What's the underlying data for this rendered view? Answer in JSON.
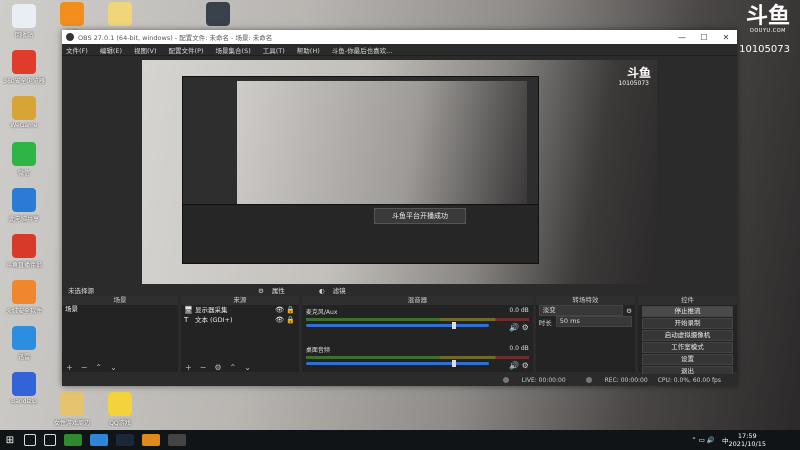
{
  "desktop": {
    "icons_left": [
      {
        "label": "回收站",
        "color": "#e8eef3"
      },
      {
        "label": "360安全浏览器",
        "color": "#e13b2c"
      },
      {
        "label": "WeGame",
        "color": "#d7a437"
      },
      {
        "label": "微信",
        "color": "#2fb446"
      },
      {
        "label": "此电脑共享",
        "color": "#2a7ad6"
      },
      {
        "label": "斗鱼直播伴侣",
        "color": "#d83a2a"
      },
      {
        "label": "火绒安全软件",
        "color": "#f0872c"
      },
      {
        "label": "迅雷",
        "color": "#2d8ee0"
      },
      {
        "label": "Bandizip",
        "color": "#3264d8"
      }
    ],
    "icons_top": [
      {
        "label": "斗鱼",
        "color": "#f28e1c"
      },
      {
        "label": "",
        "color": "#f1d57a"
      },
      {
        "label": "",
        "color": "#39414a"
      }
    ],
    "icons_bottom": [
      {
        "label": "女性游戏周边",
        "color": "#e6c36e"
      },
      {
        "label": "QQ游戏",
        "color": "#f4d23c"
      }
    ],
    "watermark": {
      "logo": "斗鱼",
      "site": "DOUYU.COM",
      "room": "10105073"
    }
  },
  "obs": {
    "title": "OBS 27.0.1 (64-bit, windows) - 配置文件: 未命名 - 场景: 未命名",
    "window_controls": [
      "—",
      "☐",
      "✕"
    ],
    "menu": [
      "文件(F)",
      "编辑(E)",
      "视图(V)",
      "配置文件(P)",
      "场景集合(S)",
      "工具(T)",
      "帮助(H)",
      "斗鱼-你最后也喜欢..."
    ],
    "preview": {
      "toast": "斗鱼平台开播成功",
      "logo": "斗鱼",
      "room": "10105073"
    },
    "scene_bar": {
      "current": "未选择源",
      "properties": "属性",
      "filters": "滤镜"
    },
    "docks": {
      "scenes": {
        "title": "场景",
        "items": [
          "场景"
        ]
      },
      "sources": {
        "title": "来源",
        "items": [
          {
            "icon": "🖥",
            "label": "显示器采集"
          },
          {
            "icon": "T",
            "label": "文本 (GDI+)"
          }
        ]
      },
      "mixer": {
        "title": "混音器",
        "channels": [
          {
            "name": "麦克风/Aux",
            "db": "0.0 dB"
          },
          {
            "name": "桌面音频",
            "db": "0.0 dB"
          }
        ]
      },
      "transitions": {
        "title": "转场特效",
        "type": "淡变",
        "duration_label": "时长",
        "duration": "50 ms"
      },
      "controls": {
        "title": "控件",
        "buttons": [
          "停止推流",
          "开始录制",
          "启动虚拟摄像机",
          "工作室模式",
          "设置",
          "退出"
        ]
      }
    },
    "status": {
      "live": "LIVE: 00:00:00",
      "rec": "REC: 00:00:00",
      "cpu": "CPU: 0.0%, 60.00 fps"
    }
  },
  "taskbar": {
    "time": "17:59",
    "date": "2021/10/15",
    "ime": "中",
    "icons": [
      {
        "name": "search",
        "color": "#ffffff"
      },
      {
        "name": "task-view",
        "color": "#ffffff"
      },
      {
        "name": "app-green",
        "color": "#2d8a2d"
      },
      {
        "name": "edge",
        "color": "#2f86d8"
      },
      {
        "name": "steam",
        "color": "#1b2838"
      },
      {
        "name": "douyu-app",
        "color": "#e08a1e"
      },
      {
        "name": "obs",
        "color": "#444444"
      }
    ]
  }
}
